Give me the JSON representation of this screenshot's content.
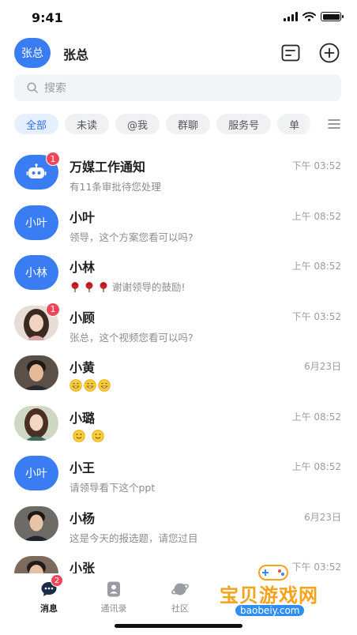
{
  "status_bar": {
    "time": "9:41"
  },
  "header": {
    "avatar_text": "张总",
    "name": "张总",
    "icons": [
      "notes-icon",
      "plus-circle-icon"
    ]
  },
  "search": {
    "placeholder": "搜索"
  },
  "filters": [
    "全部",
    "未读",
    "@我",
    "群聊",
    "服务号",
    "单"
  ],
  "active_filter": "全部",
  "conversations": [
    {
      "name": "万媒工作通知",
      "time": "下午 03:52",
      "preview": "有11条审批待您处理",
      "badge": "1",
      "avatar": "robot"
    },
    {
      "name": "小叶",
      "time": "上午 08:52",
      "preview": "领导，这个方案您看可以吗?",
      "avatar_text": "小叶"
    },
    {
      "name": "小林",
      "time": "上午 08:52",
      "preview": "谢谢领导的鼓励!",
      "avatar_text": "小林",
      "prefix_icons": [
        "rose-icon",
        "rose-icon",
        "rose-icon"
      ]
    },
    {
      "name": "小顾",
      "time": "下午 03:52",
      "preview": "张总，这个视频您看可以吗?",
      "badge": "1",
      "avatar": "photo"
    },
    {
      "name": "小黄",
      "time": "6月23日",
      "preview": "",
      "avatar": "photo",
      "prefix_icons": [
        "grin-icon",
        "grin-icon",
        "grin-icon"
      ]
    },
    {
      "name": "小璐",
      "time": "上午 08:52",
      "preview": "",
      "avatar": "photo",
      "prefix_icons": [
        "smile-icon",
        "smile-icon"
      ]
    },
    {
      "name": "小王",
      "time": "上午 08:52",
      "preview": "请领导看下这个ppt",
      "avatar_text": "小叶"
    },
    {
      "name": "小杨",
      "time": "6月23日",
      "preview": "这是今天的报选题，请您过目",
      "avatar": "photo"
    },
    {
      "name": "小张",
      "time": "下午 03:52",
      "preview": "",
      "avatar": "photo"
    }
  ],
  "tabbar": {
    "items": [
      {
        "label": "消息",
        "badge": "2",
        "icon": "chat-icon",
        "active": true
      },
      {
        "label": "通讯录",
        "icon": "contacts-icon"
      },
      {
        "label": "社区",
        "icon": "planet-icon"
      }
    ]
  },
  "watermark": {
    "text": "宝贝游戏网",
    "url": "baobeiy.com"
  },
  "colors": {
    "accent": "#3a7cf2",
    "badge": "#f0465a",
    "chip_bg": "#f0f1f3",
    "chip_active_text": "#2b6ef6"
  }
}
